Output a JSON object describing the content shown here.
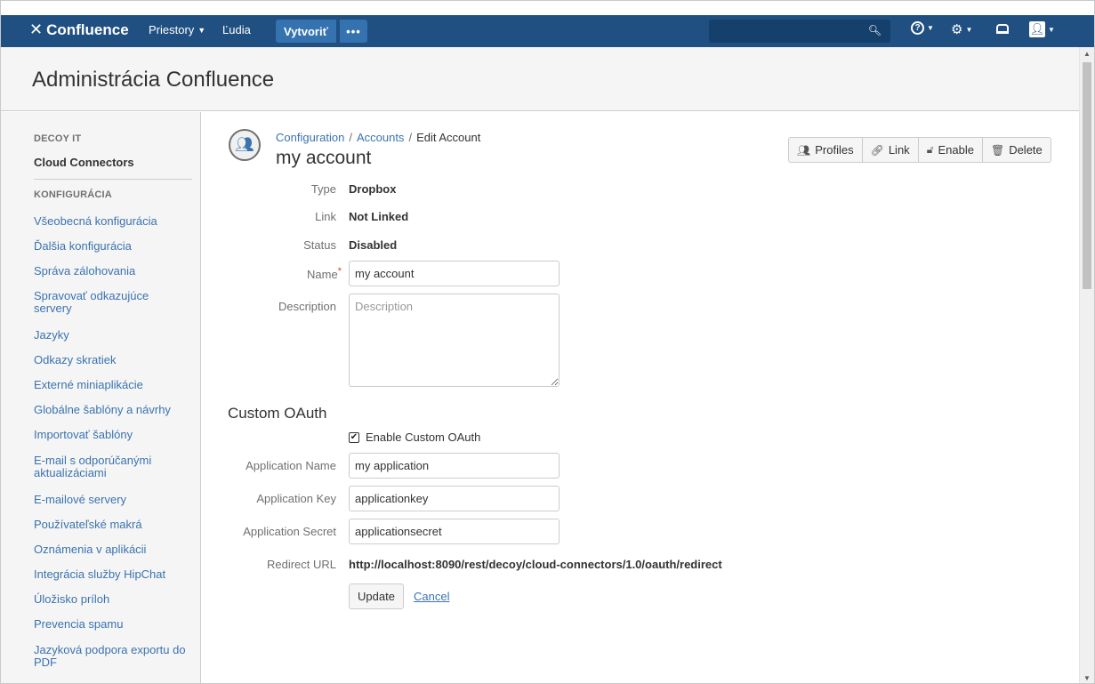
{
  "topbar": {
    "logo": "Confluence",
    "nav": [
      {
        "label": "Priestory"
      },
      {
        "label": "Ľudia"
      }
    ],
    "create_label": "Vytvoriť",
    "more_label": "•••"
  },
  "header": {
    "title": "Administrácia Confluence"
  },
  "sidebar": {
    "sections": [
      {
        "title": "DECOY IT",
        "active": "Cloud Connectors"
      },
      {
        "title": "KONFIGURÁCIA"
      }
    ],
    "items": [
      {
        "label": "Všeobecná konfigurácia"
      },
      {
        "label": "Ďalšia konfigurácia"
      },
      {
        "label": "Správa zálohovania"
      },
      {
        "label": "Spravovať odkazujúce servery"
      },
      {
        "label": "Jazyky"
      },
      {
        "label": "Odkazy skratiek"
      },
      {
        "label": "Externé miniaplikácie"
      },
      {
        "label": "Globálne šablóny a návrhy"
      },
      {
        "label": "Importovať šablóny"
      },
      {
        "label": "E-mail s odporúčanými aktualizáciami"
      },
      {
        "label": "E-mailové servery"
      },
      {
        "label": "Používateľské makrá"
      },
      {
        "label": "Oznámenia v aplikácii"
      },
      {
        "label": "Integrácia služby HipChat"
      },
      {
        "label": "Úložisko príloh"
      },
      {
        "label": "Prevencia spamu"
      },
      {
        "label": "Jazyková podpora exportu do PDF"
      }
    ]
  },
  "breadcrumb": {
    "items": [
      "Configuration",
      "Accounts"
    ],
    "current": "Edit Account",
    "separator": "/"
  },
  "account": {
    "title": "my account"
  },
  "actions": [
    {
      "label": "Profiles",
      "icon": "profiles-icon"
    },
    {
      "label": "Link",
      "icon": "link-icon"
    },
    {
      "label": "Enable",
      "icon": "unlock-icon"
    },
    {
      "label": "Delete",
      "icon": "trash-icon"
    }
  ],
  "details": {
    "type_label": "Type",
    "type_value": "Dropbox",
    "link_label": "Link",
    "link_value": "Not Linked",
    "status_label": "Status",
    "status_value": "Disabled"
  },
  "form": {
    "name_label": "Name",
    "name_required": "*",
    "name_value": "my account",
    "description_label": "Description",
    "description_placeholder": "Description",
    "oauth_section": "Custom OAuth",
    "enable_oauth_label": "Enable Custom OAuth",
    "enable_oauth_checked": true,
    "app_name_label": "Application Name",
    "app_name_value": "my application",
    "app_key_label": "Application Key",
    "app_key_value": "applicationkey",
    "app_secret_label": "Application Secret",
    "app_secret_value": "applicationsecret",
    "redirect_label": "Redirect URL",
    "redirect_value": "http://localhost:8090/rest/decoy/cloud-connectors/1.0/oauth/redirect",
    "update_label": "Update",
    "cancel_label": "Cancel"
  },
  "colors": {
    "topbar": "#205081",
    "button": "#3572b0",
    "link": "#3b73af",
    "required": "#d04437"
  }
}
